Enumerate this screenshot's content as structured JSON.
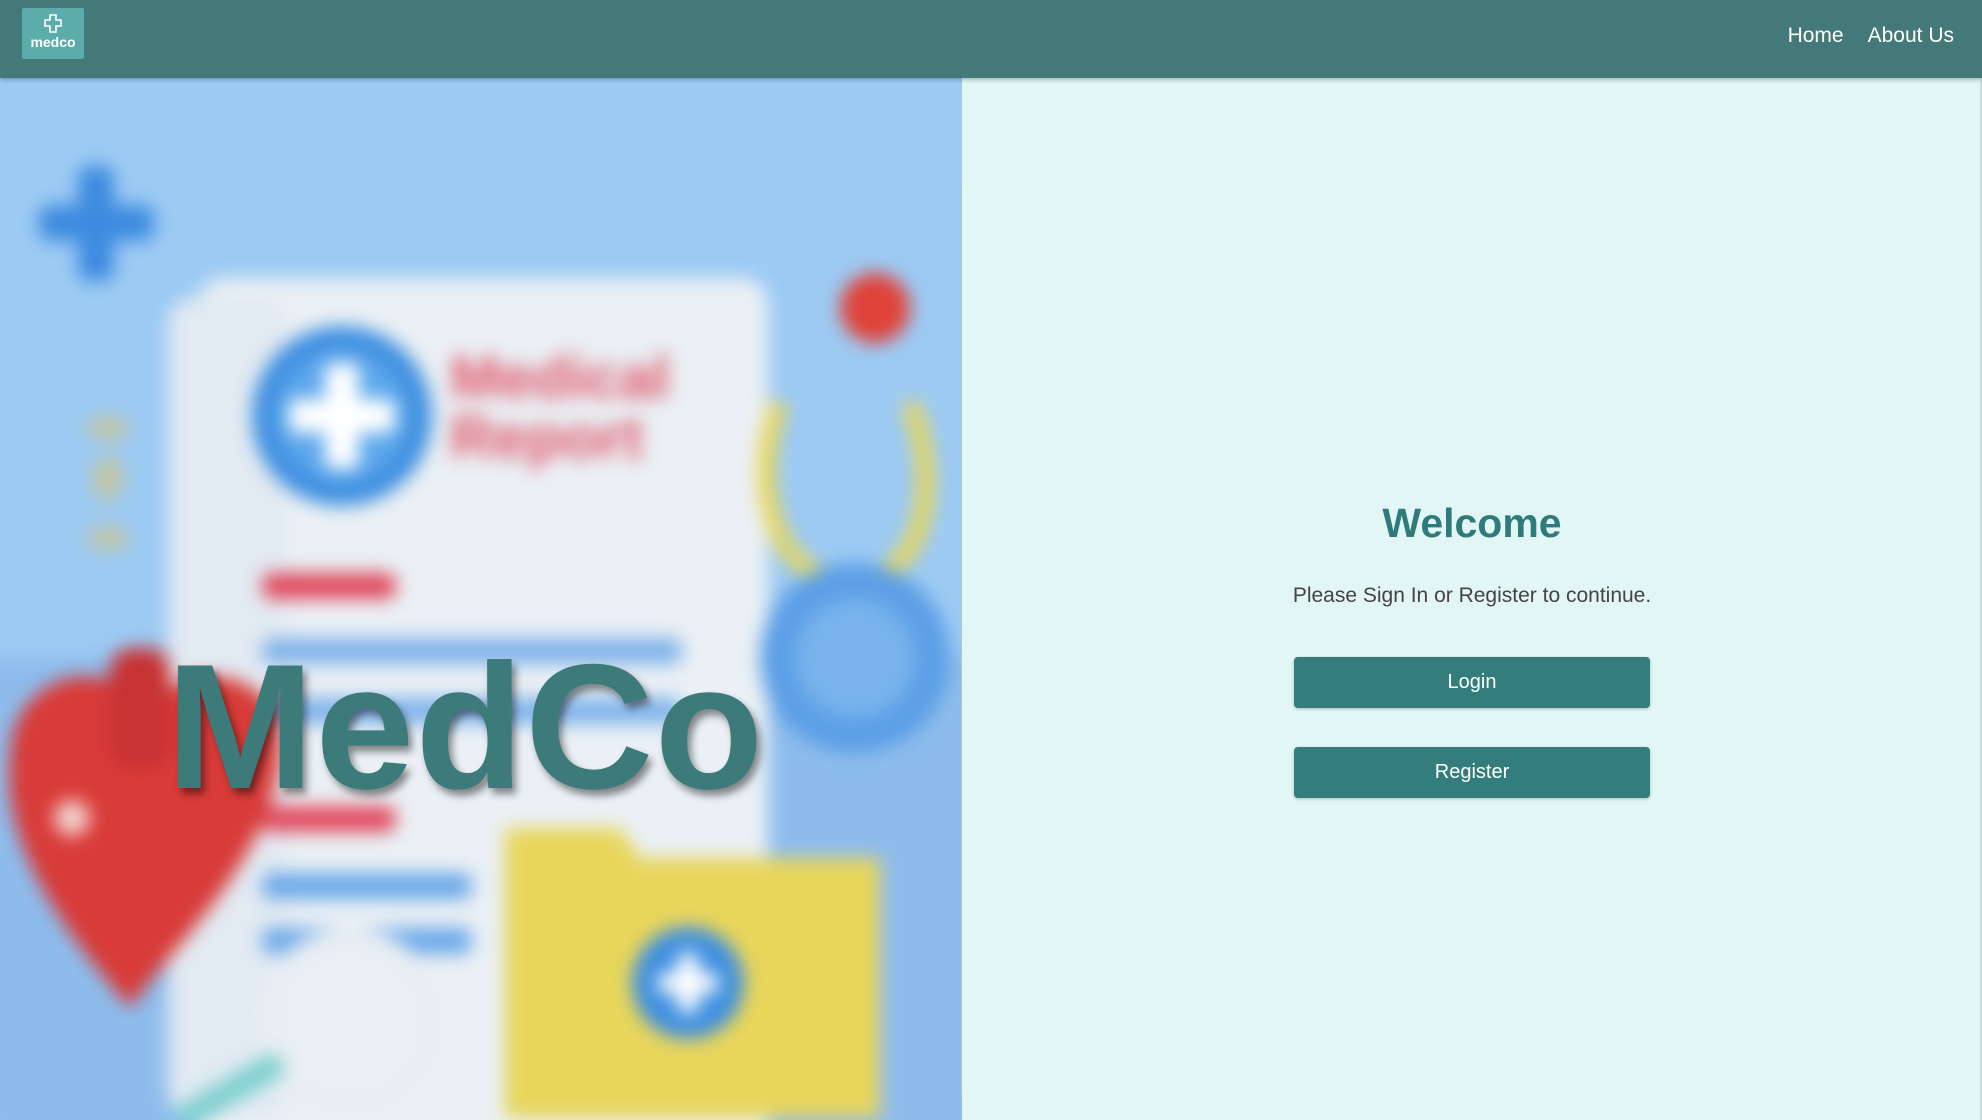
{
  "navbar": {
    "logo_text": "medco",
    "links": [
      {
        "label": "Home"
      },
      {
        "label": "About Us"
      }
    ],
    "colors": {
      "background": "#437979",
      "logo_background": "#5aadaa"
    }
  },
  "hero": {
    "brand_text": "MedCo",
    "background_art": {
      "icons": [
        "plus-cross-icon",
        "medical-report-document",
        "stethoscope-icon",
        "heart-icon",
        "magnifier-icon",
        "medical-folder-icon",
        "dna-icon"
      ],
      "report_title_line1": "Medical",
      "report_title_line2": "Report"
    }
  },
  "panel": {
    "title": "Welcome",
    "subtitle": "Please Sign In or Register to continue.",
    "login_label": "Login",
    "register_label": "Register",
    "colors": {
      "background": "#e3f6f6",
      "accent": "#337d7c",
      "title": "#2f7a7a"
    }
  }
}
